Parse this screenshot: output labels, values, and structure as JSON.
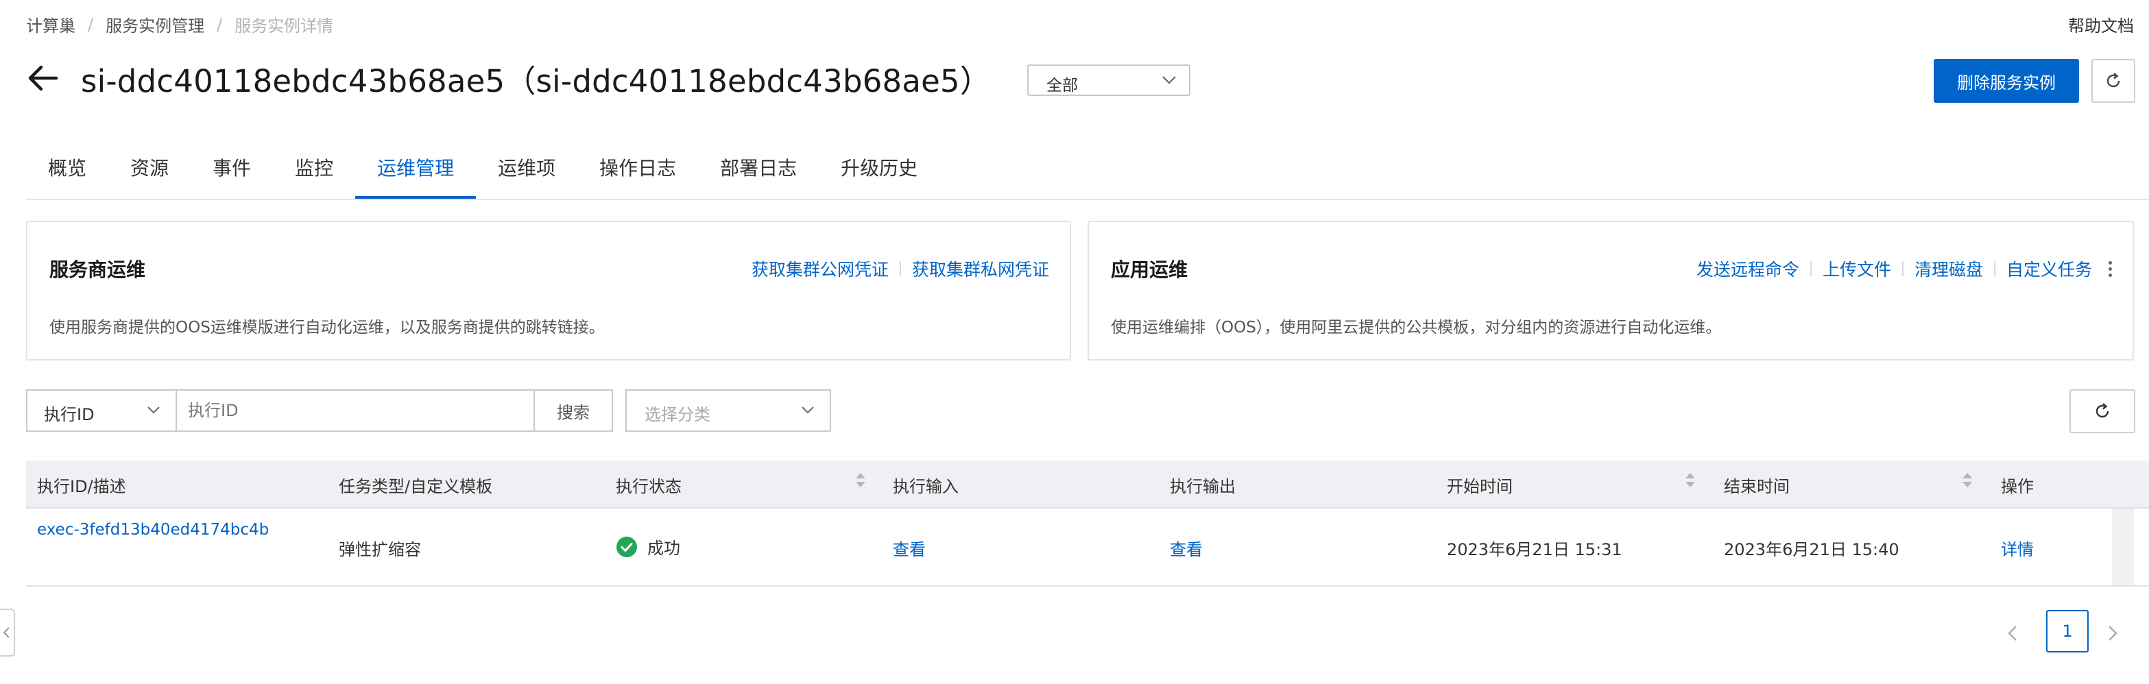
{
  "breadcrumb": [
    "计算巢",
    "服务实例管理",
    "服务实例详情"
  ],
  "breadcrumb_sep": "/",
  "help_link": "帮助文档",
  "header": {
    "title": "si-ddc40118ebdc43b68ae5（si-ddc40118ebdc43b68ae5）",
    "scope_value": "全部",
    "delete_button": "删除服务实例"
  },
  "tabs": [
    {
      "label": "概览",
      "active": false
    },
    {
      "label": "资源",
      "active": false
    },
    {
      "label": "事件",
      "active": false
    },
    {
      "label": "监控",
      "active": false
    },
    {
      "label": "运维管理",
      "active": true
    },
    {
      "label": "运维项",
      "active": false
    },
    {
      "label": "操作日志",
      "active": false
    },
    {
      "label": "部署日志",
      "active": false
    },
    {
      "label": "升级历史",
      "active": false
    }
  ],
  "provider_card": {
    "title": "服务商运维",
    "description": "使用服务商提供的OOS运维模版进行自动化运维，以及服务商提供的跳转链接。",
    "links": [
      "获取集群公网凭证",
      "获取集群私网凭证"
    ]
  },
  "app_card": {
    "title": "应用运维",
    "description": "使用运维编排（OOS），使用阿里云提供的公共模板，对分组内的资源进行自动化运维。",
    "links": [
      "发送远程命令",
      "上传文件",
      "清理磁盘",
      "自定义任务"
    ]
  },
  "filter": {
    "field_value": "执行ID",
    "search_placeholder": "执行ID",
    "search_button": "搜索",
    "category_placeholder": "选择分类"
  },
  "table": {
    "columns": [
      "执行ID/描述",
      "任务类型/自定义模板",
      "执行状态",
      "执行输入",
      "执行输出",
      "开始时间",
      "结束时间",
      "操作"
    ],
    "rows": [
      {
        "exec_id": "exec-3fefd13b40ed4174bc4b",
        "task_type": "弹性扩缩容",
        "status": "成功",
        "input": "查看",
        "output": "查看",
        "start_time": "2023年6月21日 15:31",
        "end_time": "2023年6月21日 15:40",
        "action": "详情"
      }
    ]
  },
  "pagination": {
    "current_page": "1"
  },
  "colors": {
    "primary": "#0064c8",
    "success": "#23a55a",
    "header_bg": "#eef0f3"
  },
  "icons": [
    "back-arrow-icon",
    "chevron-down-icon",
    "refresh-icon",
    "more-vertical-icon",
    "sort-icon",
    "success-check-icon",
    "chevron-left-icon",
    "chevron-right-icon"
  ]
}
